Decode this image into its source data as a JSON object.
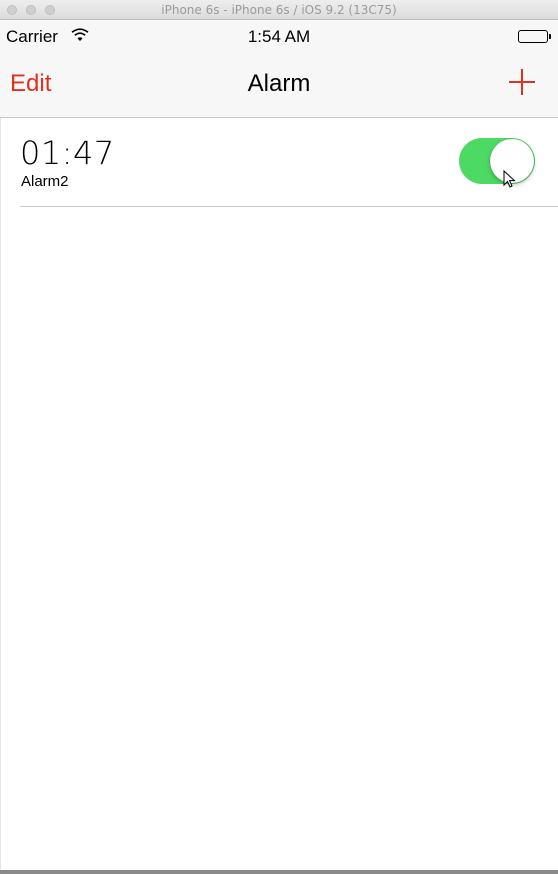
{
  "window": {
    "title": "iPhone 6s - iPhone 6s / iOS 9.2 (13C75)"
  },
  "status_bar": {
    "carrier": "Carrier",
    "time": "1:54 AM"
  },
  "nav": {
    "edit_label": "Edit",
    "title": "Alarm",
    "add_icon": "plus-icon"
  },
  "alarms": [
    {
      "time": "01:47",
      "label": "Alarm2",
      "enabled": true
    }
  ],
  "colors": {
    "accent": "#e0301e",
    "toggle_on": "#4cd964",
    "separator": "#c8c7cc"
  }
}
